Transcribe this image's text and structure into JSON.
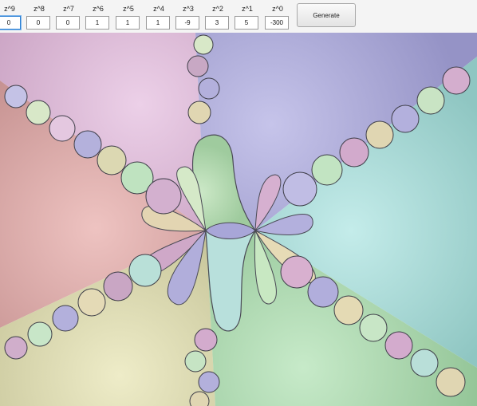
{
  "coefficients": [
    {
      "label": "z^9",
      "value": "0"
    },
    {
      "label": "z^8",
      "value": "0"
    },
    {
      "label": "z^7",
      "value": "0"
    },
    {
      "label": "z^6",
      "value": "1"
    },
    {
      "label": "z^5",
      "value": "1"
    },
    {
      "label": "z^4",
      "value": "1"
    },
    {
      "label": "z^3",
      "value": "-9"
    },
    {
      "label": "z^2",
      "value": "3"
    },
    {
      "label": "z^1",
      "value": "5"
    },
    {
      "label": "z^0",
      "value": "-300"
    }
  ],
  "generate_label": "Generate",
  "colors": {
    "pink": "#d6aed0",
    "lavender": "#aaa8d6",
    "cyan": "#a5d6d4",
    "rose": "#d9a6a4",
    "yellow": "#dcdab0",
    "green": "#a8d4ac",
    "focus": "#2a7fd4"
  }
}
